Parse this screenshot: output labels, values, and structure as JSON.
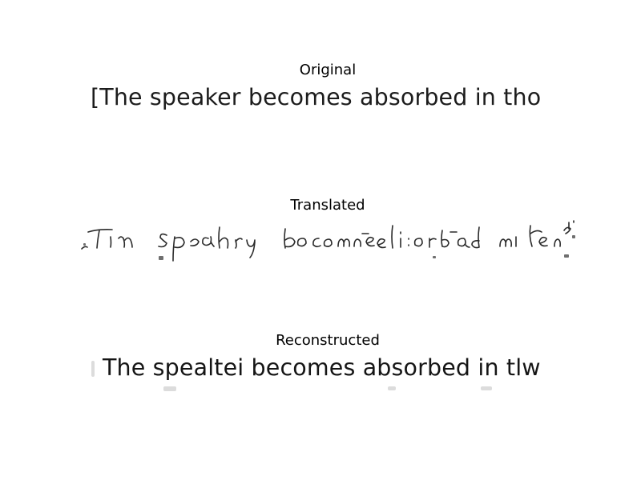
{
  "panels": {
    "original": {
      "title": "Original",
      "text": "[The speaker becomes absorbed in tho"
    },
    "translated": {
      "title": "Translated"
    },
    "reconstructed": {
      "title": "Reconstructed",
      "text": "The spealtei becomes absorbed in tlw"
    }
  }
}
